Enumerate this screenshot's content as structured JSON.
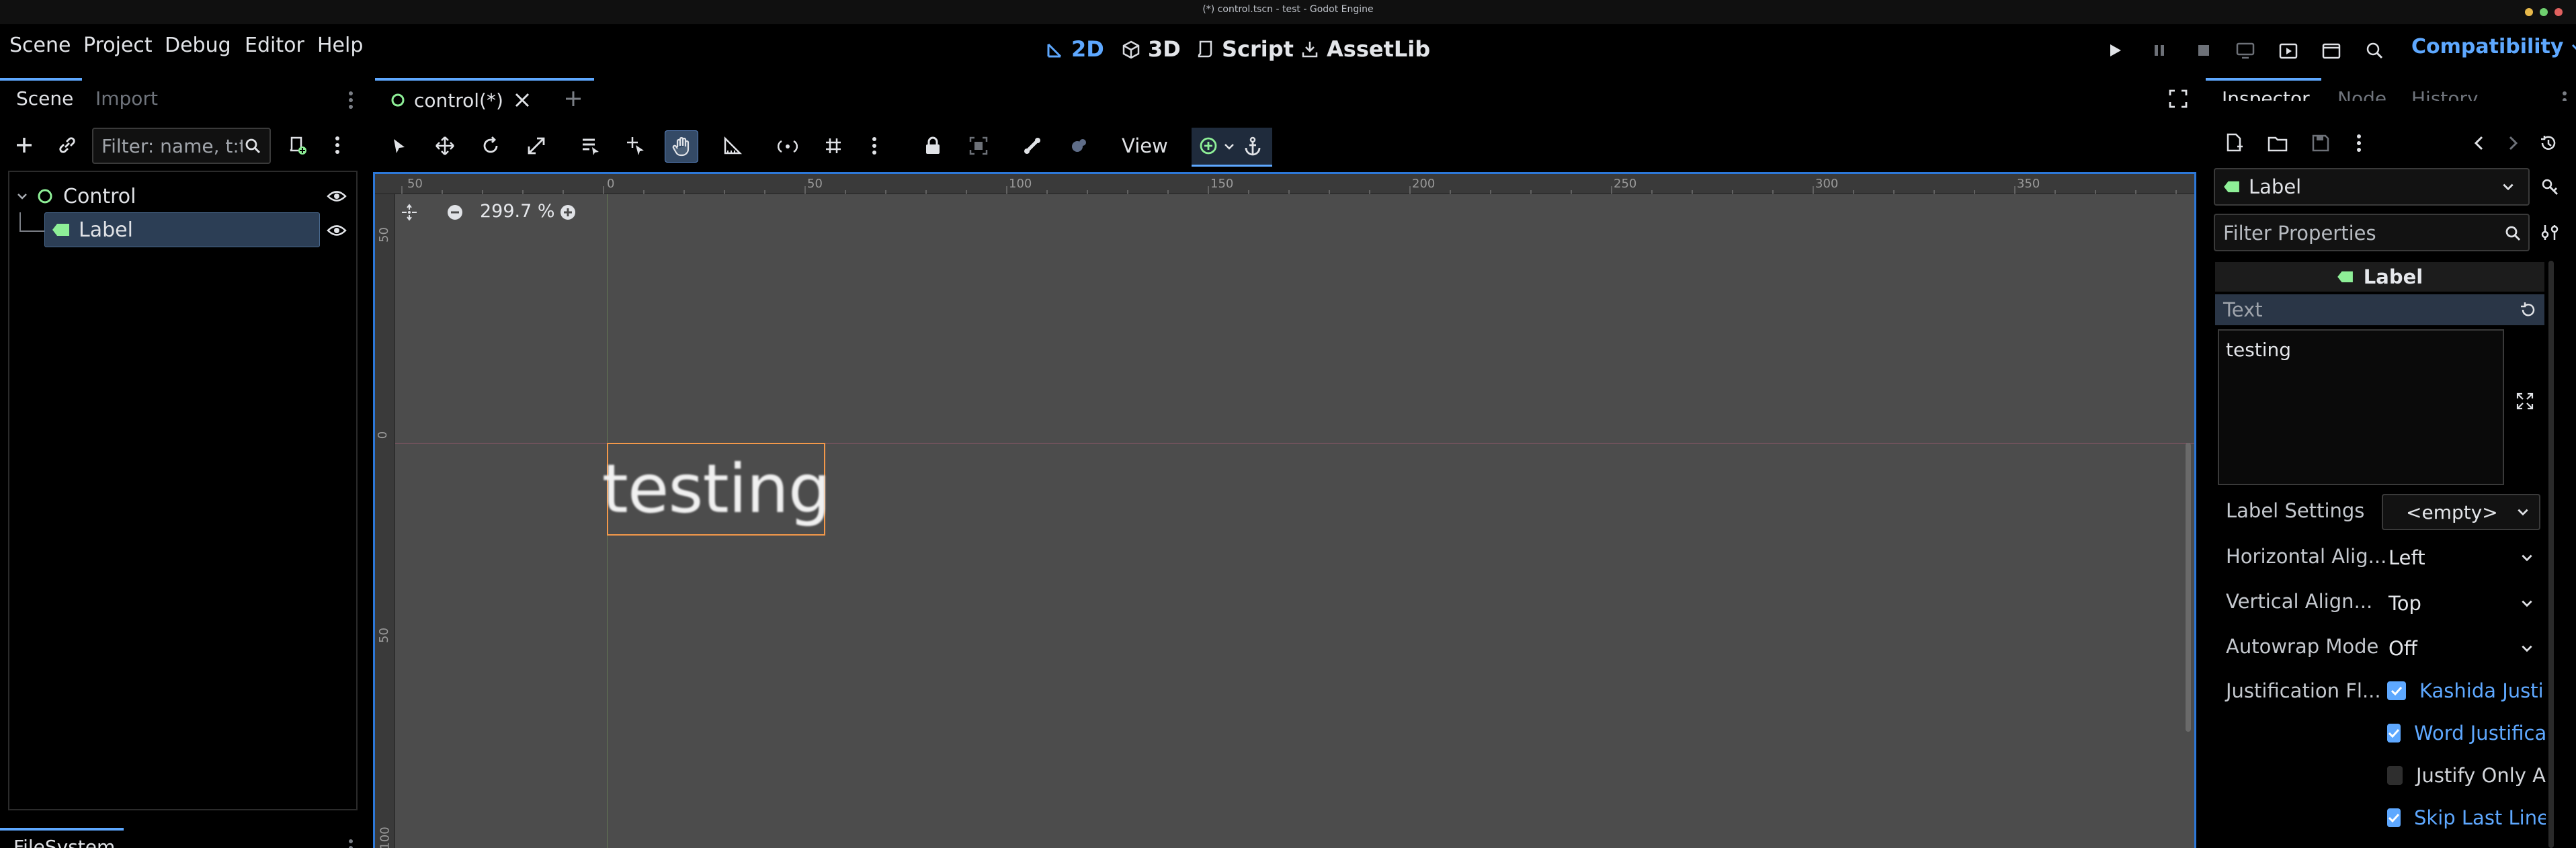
{
  "window": {
    "title": "(*) control.tscn - test - Godot Engine"
  },
  "menu": {
    "scene": "Scene",
    "project": "Project",
    "debug": "Debug",
    "editor": "Editor",
    "help": "Help"
  },
  "main_screens": {
    "b2d": "2D",
    "b3d": "3D",
    "script": "Script",
    "assetlib": "AssetLib"
  },
  "renderer": "Compatibility",
  "scene_dock": {
    "tabs": {
      "scene": "Scene",
      "import": "Import"
    },
    "filter_placeholder": "Filter: name, t:type, g:group",
    "tree": {
      "root": "Control",
      "child": "Label"
    }
  },
  "filesystem_tab": "FileSystem",
  "editor_tabs": {
    "active": "control(*)"
  },
  "toolbar": {
    "view": "View"
  },
  "viewport": {
    "zoom": "299.7 %",
    "label_text": "testing",
    "ruler_top": [
      "50",
      "0",
      "50",
      "100",
      "150",
      "200",
      "250",
      "300",
      "350"
    ],
    "ruler_left": [
      "50",
      "0",
      "50",
      "100"
    ]
  },
  "inspector": {
    "tabs": {
      "inspector": "Inspector",
      "node": "Node",
      "history": "History"
    },
    "object": "Label",
    "filter_placeholder": "Filter Properties",
    "section": "Label",
    "text_label": "Text",
    "text_value": "testing",
    "props": {
      "label_settings": {
        "name": "Label Settings",
        "value": "<empty>"
      },
      "h_align": {
        "name": "Horizontal Alig...",
        "value": "Left"
      },
      "v_align": {
        "name": "Vertical Align...",
        "value": "Top"
      },
      "autowrap": {
        "name": "Autowrap Mode",
        "value": "Off"
      },
      "justification": {
        "name": "Justification Fl..."
      }
    },
    "flags": [
      {
        "label": "Kashida Justi",
        "checked": true
      },
      {
        "label": "Word Justifica",
        "checked": true
      },
      {
        "label": "Justify Only A",
        "checked": false
      },
      {
        "label": "Skip Last Line",
        "checked": true
      }
    ]
  },
  "colors": {
    "accent": "#5ea8ff",
    "node_green": "#8eef97",
    "selection": "#f2984a"
  }
}
